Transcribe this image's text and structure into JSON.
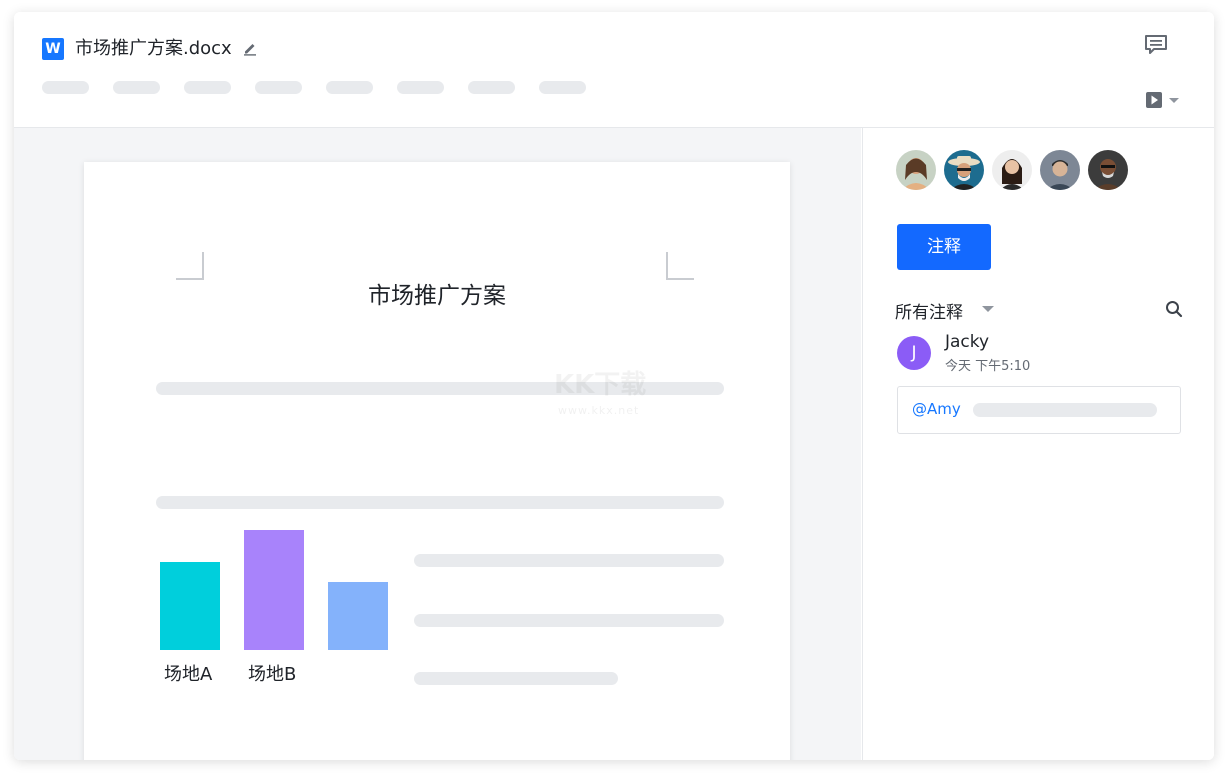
{
  "header": {
    "app_letter": "W",
    "doc_title": "市场推广方案.docx",
    "toolbar_placeholder_count": 8
  },
  "document": {
    "page_title": "市场推广方案",
    "watermark": "KK下载",
    "watermark_url": "www.kkx.net",
    "chart_labels": [
      "场地A",
      "场地B"
    ]
  },
  "sidebar": {
    "annotate_button": "注释",
    "filter_label": "所有注释",
    "comments": [
      {
        "avatar_letter": "J",
        "author": "Jacky",
        "time": "今天  下午5:10"
      }
    ],
    "reply": {
      "mention": "@Amy"
    }
  },
  "chart_data": {
    "type": "bar",
    "categories": [
      "场地A",
      "场地B",
      ""
    ],
    "values": [
      88,
      120,
      68
    ],
    "colors": [
      "#00cfdc",
      "#a883fb",
      "#84b2fb"
    ]
  },
  "colors": {
    "accent": "#1369ff",
    "word_blue": "#1677ff",
    "avatar_purple": "#8b5cf6"
  }
}
